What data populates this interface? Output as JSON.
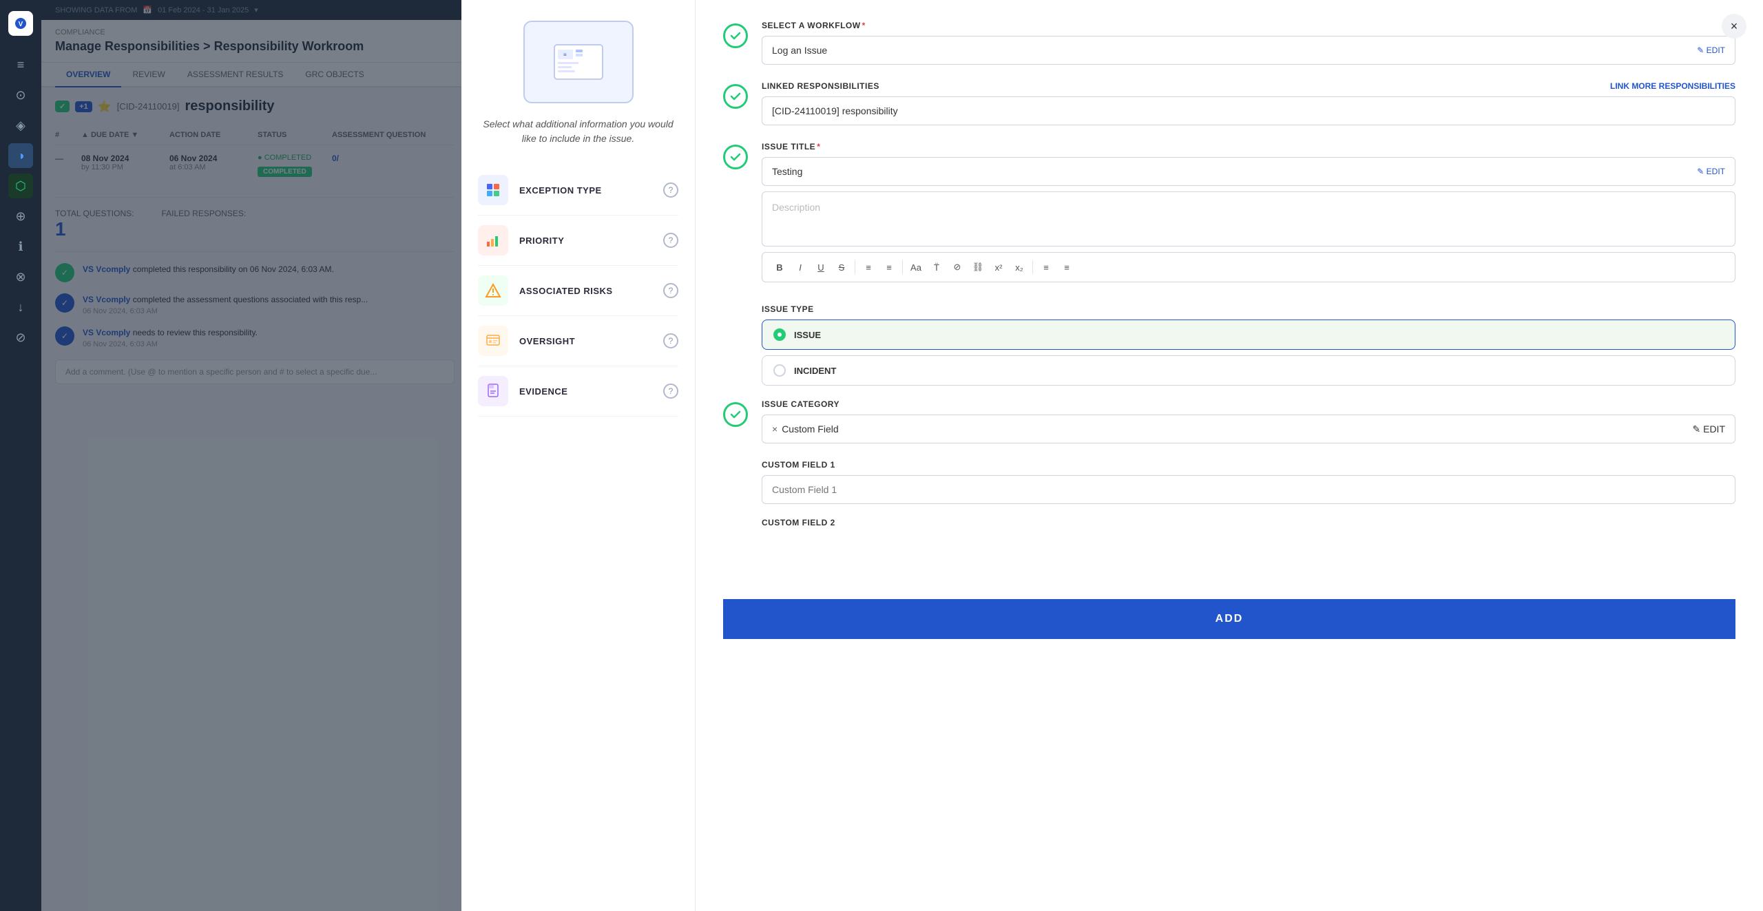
{
  "app": {
    "logo": "V",
    "showing_data_label": "SHOWING DATA FROM",
    "date_range": "01 Feb 2024 - 31 Jan 2025"
  },
  "sidebar": {
    "icons": [
      "≡",
      "⊙",
      "◈",
      "◑",
      "⬡",
      "⊕",
      "ℹ",
      "⊗",
      "↓",
      "⊘"
    ]
  },
  "page": {
    "section": "COMPLIANCE",
    "title": "Manage Responsibilities > Responsibility Workroom",
    "tabs": [
      {
        "label": "OVERVIEW",
        "active": true
      },
      {
        "label": "REVIEW"
      },
      {
        "label": "ASSESSMENT RESULTS"
      },
      {
        "label": "GRC OBJECTS"
      }
    ],
    "responsibility_id": "[CID-24110019]",
    "responsibility_name": "responsibility",
    "table": {
      "headers": [
        "#",
        "DUE DATE",
        "ACTION DATE",
        "STATUS",
        "ASSESSMENT QUESTION"
      ],
      "rows": [
        {
          "num": "—",
          "due_date": "08 Nov 2024",
          "due_time": "by 11:30 PM",
          "action_date": "06 Nov 2024",
          "action_time": "at 6:03 AM",
          "status": "● COMPLETED",
          "status_badge": "COMPLETED",
          "assessment": "0/"
        }
      ]
    },
    "stats": {
      "total_label": "TOTAL QUESTIONS:",
      "total_value": "1",
      "failed_label": "FAILED RESPONSES:",
      "failed_value": ""
    },
    "activities": [
      {
        "icon": "✓",
        "type": "green",
        "text_prefix": "VS Vcomply",
        "text_suffix": "completed this responsibility on 06 Nov 2024, 6:03 AM.",
        "time": ""
      },
      {
        "icon": "✓",
        "type": "blue",
        "text_prefix": "VS Vcomply",
        "text_suffix": "completed the assessment questions associated with this resp...",
        "time": "06 Nov 2024, 6:03 AM"
      },
      {
        "icon": "✓",
        "type": "blue",
        "text_prefix": "VS Vcomply",
        "text_suffix": "needs to review this responsibility.",
        "time": "06 Nov 2024, 6:03 AM"
      }
    ],
    "comment_placeholder": "Add a comment. (Use @ to mention a specific person and # to select a specific due..."
  },
  "modal": {
    "illustration_alt": "Workflow illustration",
    "description": "Select what additional information you would like to include in the issue.",
    "steps": [
      {
        "id": "exception_type",
        "label": "EXCEPTION TYPE",
        "icon_type": "exception"
      },
      {
        "id": "priority",
        "label": "PRIORITY",
        "icon_type": "priority"
      },
      {
        "id": "associated_risks",
        "label": "ASSOCIATED RISKS",
        "icon_type": "risks"
      },
      {
        "id": "oversight",
        "label": "OVERSIGHT",
        "icon_type": "oversight"
      },
      {
        "id": "evidence",
        "label": "EVIDENCE",
        "icon_type": "evidence"
      }
    ],
    "close_label": "×",
    "sections": {
      "workflow": {
        "label": "SELECT A WORKFLOW",
        "required": true,
        "value": "Log an Issue",
        "edit_label": "✎ EDIT",
        "link_label": ""
      },
      "linked_responsibilities": {
        "label": "LINKED RESPONSIBILITIES",
        "link_label": "LINK MORE RESPONSIBILITIES",
        "value": "[CID-24110019] responsibility"
      },
      "issue_title": {
        "label": "ISSUE TITLE",
        "required": true,
        "value": "Testing",
        "edit_label": "✎ EDIT"
      },
      "description": {
        "placeholder": "Description",
        "toolbar": [
          "B",
          "I",
          "U",
          "S",
          "≡",
          "≡",
          "Aa",
          "T̈",
          "⊘",
          "⛓",
          "x²",
          "x₂",
          "≡",
          "≡"
        ]
      },
      "issue_type": {
        "label": "ISSUE TYPE",
        "options": [
          {
            "value": "ISSUE",
            "selected": true
          },
          {
            "value": "INCIDENT",
            "selected": false
          }
        ]
      },
      "issue_category": {
        "label": "ISSUE CATEGORY",
        "value": "Custom Field",
        "edit_label": "✎ EDIT"
      },
      "custom_field_1": {
        "label": "CUSTOM FIELD 1",
        "placeholder": "Custom Field 1"
      },
      "custom_field_2": {
        "label": "CUSTOM FIELD 2",
        "placeholder": ""
      }
    },
    "add_button": "ADD"
  }
}
